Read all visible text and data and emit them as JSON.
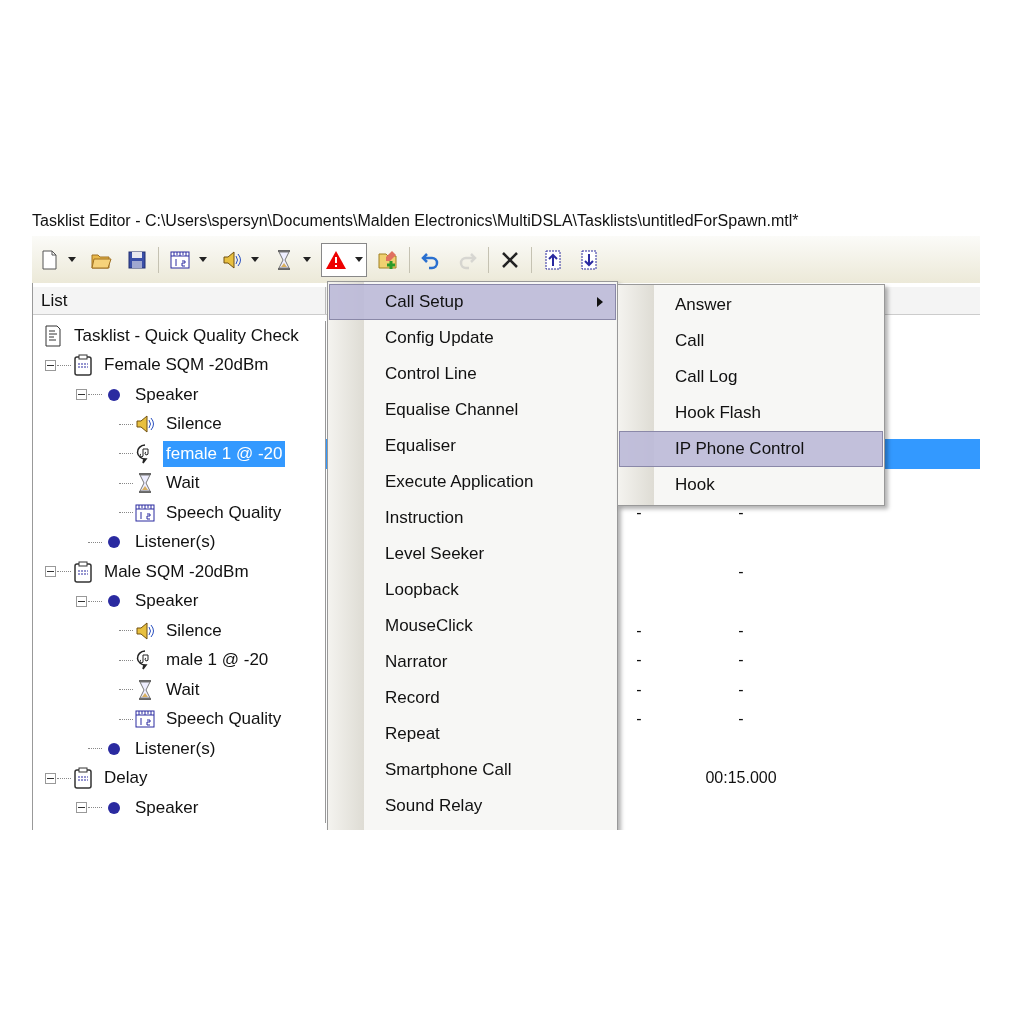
{
  "window": {
    "title": "Tasklist Editor - C:\\Users\\spersyn\\Documents\\Malden Electronics\\MultiDSLA\\Tasklists\\untitledForSpawn.mtl*"
  },
  "toolbar": [
    {
      "kind": "new",
      "dropdown": true,
      "pressed": false,
      "disabled": false
    },
    {
      "kind": "open",
      "dropdown": false,
      "pressed": false,
      "disabled": false
    },
    {
      "kind": "save",
      "dropdown": false,
      "pressed": false,
      "disabled": false
    },
    {
      "kind": "separator"
    },
    {
      "kind": "ruler",
      "dropdown": true,
      "pressed": false,
      "disabled": false
    },
    {
      "kind": "speaker",
      "dropdown": true,
      "pressed": false,
      "disabled": false
    },
    {
      "kind": "hourglass",
      "dropdown": true,
      "pressed": false,
      "disabled": false
    },
    {
      "kind": "warning",
      "dropdown": true,
      "pressed": true,
      "disabled": false
    },
    {
      "kind": "add",
      "dropdown": false,
      "pressed": false,
      "disabled": false
    },
    {
      "kind": "separator"
    },
    {
      "kind": "undo",
      "dropdown": false,
      "pressed": false,
      "disabled": false
    },
    {
      "kind": "redo",
      "dropdown": false,
      "pressed": false,
      "disabled": true
    },
    {
      "kind": "separator"
    },
    {
      "kind": "delete",
      "dropdown": false,
      "pressed": false,
      "disabled": false
    },
    {
      "kind": "separator"
    },
    {
      "kind": "up",
      "dropdown": false,
      "pressed": false,
      "disabled": false
    },
    {
      "kind": "down",
      "dropdown": false,
      "pressed": false,
      "disabled": false
    }
  ],
  "list": {
    "header": "List",
    "tree": [
      {
        "kind": "document",
        "label": "Tasklist - Quick Quality Check",
        "selected": false,
        "children": [
          {
            "kind": "clipboard",
            "label": "Female SQM -20dBm",
            "selected": false,
            "expanded": true,
            "children": [
              {
                "kind": "dot",
                "label": "Speaker",
                "selected": false,
                "expanded": true,
                "children": [
                  {
                    "kind": "speaker",
                    "label": "Silence",
                    "selected": false
                  },
                  {
                    "kind": "voice",
                    "label": "female 1 @ -20",
                    "selected": true
                  },
                  {
                    "kind": "hourglass",
                    "label": "Wait",
                    "selected": false
                  },
                  {
                    "kind": "ruler",
                    "label": "Speech Quality",
                    "selected": false,
                    "column_2": "-",
                    "column_3": "-"
                  }
                ]
              },
              {
                "kind": "dot",
                "label": "Listener(s)",
                "selected": false
              }
            ]
          },
          {
            "kind": "clipboard",
            "label": "Male SQM -20dBm",
            "selected": false,
            "expanded": true,
            "column_3": "-",
            "children": [
              {
                "kind": "dot",
                "label": "Speaker",
                "selected": false,
                "expanded": true,
                "children": [
                  {
                    "kind": "speaker",
                    "label": "Silence",
                    "selected": false,
                    "column_2": "-",
                    "column_3": "-"
                  },
                  {
                    "kind": "voice",
                    "label": "male 1 @ -20",
                    "selected": false,
                    "column_2": "-",
                    "column_3": "-"
                  },
                  {
                    "kind": "hourglass",
                    "label": "Wait",
                    "selected": false,
                    "column_2": "-",
                    "column_3": "-"
                  },
                  {
                    "kind": "ruler",
                    "label": "Speech Quality",
                    "selected": false,
                    "column_2": "-",
                    "column_3": "-"
                  }
                ]
              },
              {
                "kind": "dot",
                "label": "Listener(s)",
                "selected": false
              }
            ]
          },
          {
            "kind": "clipboard",
            "label": "Delay",
            "selected": false,
            "expanded": true,
            "column_3": "00:15.000",
            "children": [
              {
                "kind": "dot",
                "label": "Speaker",
                "selected": false,
                "expanded": true
              }
            ]
          }
        ]
      }
    ]
  },
  "menu": {
    "items": [
      {
        "label": "Call Setup",
        "selected": true,
        "submenu": true
      },
      {
        "label": "Config Update",
        "selected": false,
        "submenu": false
      },
      {
        "label": "Control Line",
        "selected": false,
        "submenu": false
      },
      {
        "label": "Equalise Channel",
        "selected": false,
        "submenu": false
      },
      {
        "label": "Equaliser",
        "selected": false,
        "submenu": false
      },
      {
        "label": "Execute Application",
        "selected": false,
        "submenu": false
      },
      {
        "label": "Instruction",
        "selected": false,
        "submenu": false
      },
      {
        "label": "Level Seeker",
        "selected": false,
        "submenu": false
      },
      {
        "label": "Loopback",
        "selected": false,
        "submenu": false
      },
      {
        "label": "MouseClick",
        "selected": false,
        "submenu": false
      },
      {
        "label": "Narrator",
        "selected": false,
        "submenu": false
      },
      {
        "label": "Record",
        "selected": false,
        "submenu": false
      },
      {
        "label": "Repeat",
        "selected": false,
        "submenu": false
      },
      {
        "label": "Smartphone Call",
        "selected": false,
        "submenu": false
      },
      {
        "label": "Sound Relay",
        "selected": false,
        "submenu": false
      }
    ]
  },
  "submenu": {
    "items": [
      {
        "label": "Answer",
        "selected": false
      },
      {
        "label": "Call",
        "selected": false
      },
      {
        "label": "Call Log",
        "selected": false
      },
      {
        "label": "Hook Flash",
        "selected": false
      },
      {
        "label": "IP Phone Control",
        "selected": true
      },
      {
        "label": "Hook",
        "selected": false
      }
    ]
  }
}
